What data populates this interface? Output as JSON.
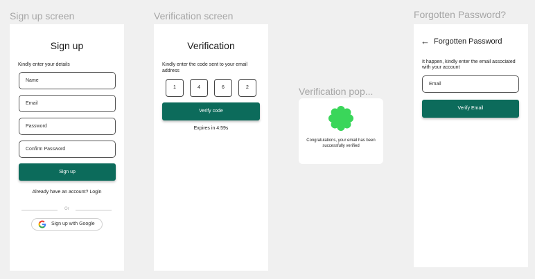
{
  "frames": {
    "signup_label": "Sign up screen",
    "verify_label": "Verification screen",
    "popup_label": "Verification pop...",
    "forgot_label": "Forgotten Password?"
  },
  "signup": {
    "title": "Sign up",
    "subtitle": "Kindly enter your details",
    "name_placeholder": "Name",
    "email_placeholder": "Email",
    "password_placeholder": "Password",
    "confirm_placeholder": "Confirm Password",
    "signup_button": "Sign up",
    "login_prompt": "Already have an account? Login",
    "or_text": "Or",
    "google_button": "Sign up with Google"
  },
  "verify": {
    "title": "Verification",
    "instructions": "Kindly enter the code sent to your email address",
    "code_digits": [
      "1",
      "4",
      "6",
      "2"
    ],
    "verify_button": "Verify code",
    "expires": "Expires in 4:59s"
  },
  "popup": {
    "message": "Congratulations, your email has been successfully verified"
  },
  "forgot": {
    "back_icon": "arrow-left-icon",
    "title": "Forgotten Password",
    "instructions": "It happen, kindly enter the email associated with your account",
    "email_placeholder": "Email",
    "verify_button": "Verify Email"
  },
  "colors": {
    "primary": "#0c6b5b",
    "success": "#3ad65a"
  }
}
